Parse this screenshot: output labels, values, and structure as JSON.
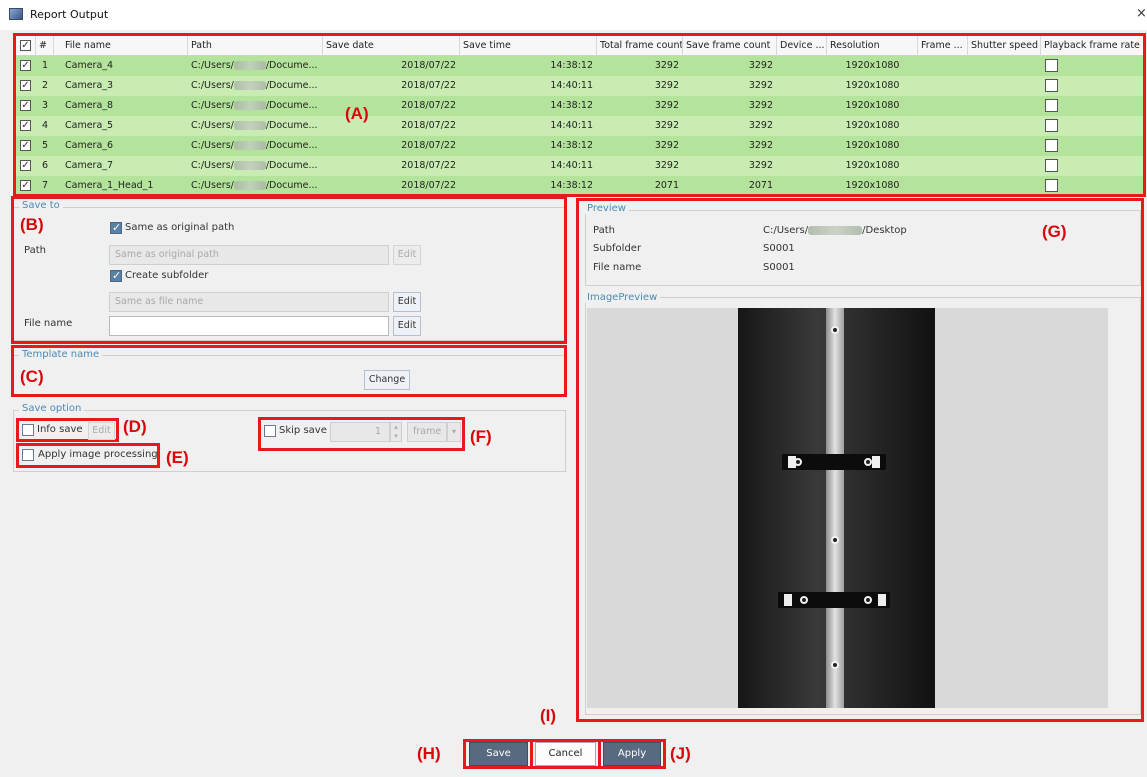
{
  "window": {
    "title": "Report Output",
    "close_glyph": "×",
    "icon": "report-output-app-icon"
  },
  "table": {
    "columns": [
      "#",
      "File name",
      "Path",
      "Save date",
      "Save time",
      "Total frame count",
      "Save frame count",
      "Device ...",
      "Resolution",
      "Frame ...",
      "Shutter speed",
      "Playback frame rate"
    ],
    "rows": [
      {
        "index": "1",
        "file": "Camera_4",
        "path_prefix": "C:/Users/",
        "path_suffix": "/Docume...",
        "date": "2018/07/22",
        "time": "14:38:12",
        "total": "3292",
        "saved": "3292",
        "resolution": "1920x1080",
        "checked": true
      },
      {
        "index": "2",
        "file": "Camera_3",
        "path_prefix": "C:/Users/",
        "path_suffix": "/Docume...",
        "date": "2018/07/22",
        "time": "14:40:11",
        "total": "3292",
        "saved": "3292",
        "resolution": "1920x1080",
        "checked": true
      },
      {
        "index": "3",
        "file": "Camera_8",
        "path_prefix": "C:/Users/",
        "path_suffix": "/Docume...",
        "date": "2018/07/22",
        "time": "14:38:12",
        "total": "3292",
        "saved": "3292",
        "resolution": "1920x1080",
        "checked": true
      },
      {
        "index": "4",
        "file": "Camera_5",
        "path_prefix": "C:/Users/",
        "path_suffix": "/Docume...",
        "date": "2018/07/22",
        "time": "14:40:11",
        "total": "3292",
        "saved": "3292",
        "resolution": "1920x1080",
        "checked": true
      },
      {
        "index": "5",
        "file": "Camera_6",
        "path_prefix": "C:/Users/",
        "path_suffix": "/Docume...",
        "date": "2018/07/22",
        "time": "14:38:12",
        "total": "3292",
        "saved": "3292",
        "resolution": "1920x1080",
        "checked": true
      },
      {
        "index": "6",
        "file": "Camera_7",
        "path_prefix": "C:/Users/",
        "path_suffix": "/Docume...",
        "date": "2018/07/22",
        "time": "14:40:11",
        "total": "3292",
        "saved": "3292",
        "resolution": "1920x1080",
        "checked": true
      },
      {
        "index": "7",
        "file": "Camera_1_Head_1",
        "path_prefix": "C:/Users/",
        "path_suffix": "/Docume...",
        "date": "2018/07/22",
        "time": "14:38:12",
        "total": "2071",
        "saved": "2071",
        "resolution": "1920x1080",
        "checked": true
      }
    ]
  },
  "save_to": {
    "legend": "Save to",
    "same_as_original_label": "Same as original path",
    "same_as_original_checked": true,
    "path_label": "Path",
    "path_placeholder": "Same as original path",
    "path_edit": "Edit",
    "create_subfolder_label": "Create subfolder",
    "create_subfolder_checked": true,
    "subfolder_placeholder": "Same as file name",
    "subfolder_edit": "Edit",
    "file_name_label": "File name",
    "file_name_value": "",
    "file_name_edit": "Edit"
  },
  "template": {
    "legend": "Template name",
    "change": "Change"
  },
  "save_option": {
    "legend": "Save option",
    "info_save": "Info save",
    "info_edit": "Edit",
    "apply_processing": "Apply image processing",
    "skip_save": "Skip save",
    "skip_value": "1",
    "skip_unit": "frame"
  },
  "preview": {
    "legend": "Preview",
    "path_label": "Path",
    "path_prefix": "C:/Users/",
    "path_suffix": "/Desktop",
    "subfolder_label": "Subfolder",
    "subfolder_value": "S0001",
    "file_label": "File name",
    "file_value": "S0001",
    "image_legend": "ImagePreview"
  },
  "buttons": {
    "save": "Save",
    "cancel": "Cancel",
    "apply": "Apply"
  },
  "markers": {
    "a": "(A)",
    "b": "(B)",
    "c": "(C)",
    "d": "(D)",
    "e": "(E)",
    "f": "(F)",
    "g": "(G)",
    "h": "(H)",
    "i": "(I)",
    "j": "(J)"
  },
  "colors": {
    "accent_red": "#e8181c",
    "row_green": "#b4e49c",
    "row_green_alt": "#c9ecb2",
    "legend_blue": "#4a8ab6",
    "button_dark": "#586a7f"
  }
}
